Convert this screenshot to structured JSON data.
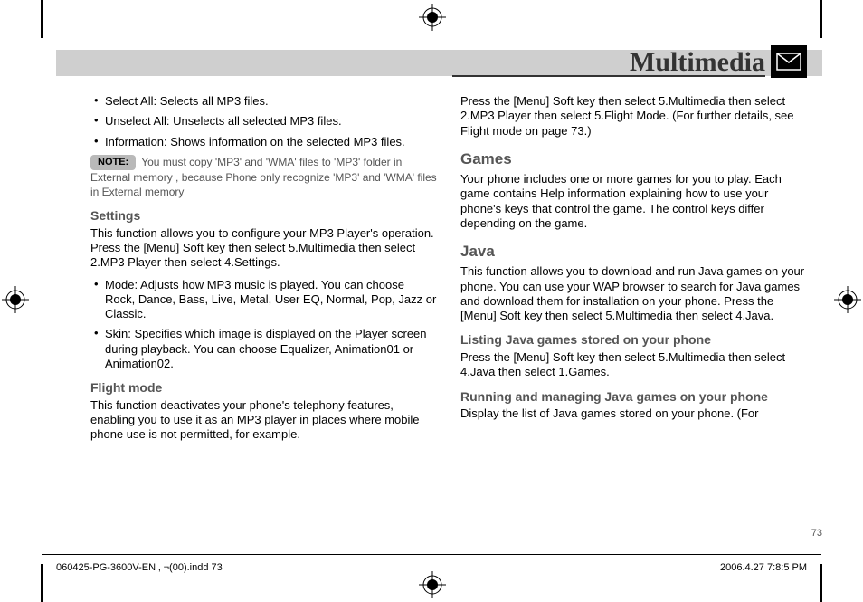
{
  "header": {
    "section_title": "Multimedia"
  },
  "left_col": {
    "bullets_top": [
      "Select All: Selects all MP3 files.",
      "Unselect All: Unselects all selected MP3 files.",
      "Information: Shows information on the selected MP3 files."
    ],
    "note_label": "NOTE:",
    "note_body": "You must copy 'MP3' and 'WMA' files to 'MP3' folder in External memory , because Phone only recognize 'MP3' and 'WMA' files in External memory",
    "settings_h": "Settings",
    "settings_p": "This function allows you to configure your MP3 Player's operation. Press the [Menu] Soft key then select 5.Multimedia then select 2.MP3 Player then select 4.Settings.",
    "settings_bullets": [
      "Mode: Adjusts how MP3 music is played. You can choose Rock, Dance, Bass, Live, Metal, User EQ, Normal, Pop, Jazz or Classic.",
      "Skin: Specifies which image is displayed on the Player screen during playback. You can choose Equalizer, Animation01 or Animation02."
    ],
    "flight_h": "Flight mode",
    "flight_p": "This function deactivates your phone's telephony features, enabling you to use it as an MP3 player in places where mobile phone use is not permitted, for example."
  },
  "right_col": {
    "flight_cont": "Press the [Menu] Soft key then select 5.Multimedia then select 2.MP3 Player then select 5.Flight Mode. (For further details, see Flight mode on page 73.)",
    "games_h": "Games",
    "games_p": "Your phone includes one or more games for you to play. Each game contains Help information explaining how to use your phone's keys that control the game. The control keys differ depending on the game.",
    "java_h": "Java",
    "java_p": "This function allows you to download and run Java games on your phone. You can use your WAP browser to search for Java games and download them for installation on your phone. Press the [Menu] Soft key then select 5.Multimedia then select 4.Java.",
    "list_h": "Listing Java games stored on your phone",
    "list_p": "Press the [Menu] Soft key then select 5.Multimedia then select 4.Java then select 1.Games.",
    "run_h": "Running and managing Java games on your phone",
    "run_p": "Display the list of Java games stored on your phone. (For"
  },
  "page_number": "73",
  "footer": {
    "left": "060425-PG-3600V-EN ‚ ¬(00).indd   73",
    "right": "2006.4.27   7:8:5 PM"
  }
}
